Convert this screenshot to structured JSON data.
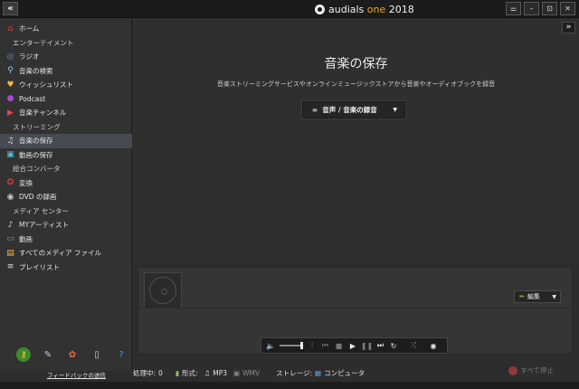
{
  "titlebar": {
    "collapse": "«",
    "brand_main": "audials ",
    "brand_accent": "one",
    "brand_year": " 2018",
    "controls": [
      "⚌",
      "–",
      "⊡",
      "✕"
    ]
  },
  "sidebar": {
    "items": [
      {
        "label": "ホーム",
        "icon": "home-icon",
        "glyph": "⌂",
        "color": "#e23b3b"
      },
      {
        "label": "エンターテイメント",
        "sub": true
      },
      {
        "label": "ラジオ",
        "icon": "radio-icon",
        "glyph": "◎",
        "color": "#3aa0e8"
      },
      {
        "label": "音楽の検索",
        "icon": "search-icon",
        "glyph": "⚲",
        "color": "#9fc8e8"
      },
      {
        "label": "ウィッシュリスト",
        "icon": "wishlist-icon",
        "glyph": "♥",
        "color": "#f0b83a"
      },
      {
        "label": "Podcast",
        "icon": "podcast-icon",
        "glyph": "●",
        "color": "#a74ad0"
      },
      {
        "label": "音楽チャンネル",
        "icon": "music-channel-icon",
        "glyph": "▶",
        "color": "#e04848"
      },
      {
        "label": "ストリーミング",
        "sub": true
      },
      {
        "label": "音楽の保存",
        "icon": "music-save-icon",
        "glyph": "♫",
        "color": "#dddddd",
        "selected": true
      },
      {
        "label": "動画の保存",
        "icon": "video-save-icon",
        "glyph": "▣",
        "color": "#48c0e0"
      },
      {
        "label": "総合コンバータ",
        "sub": true
      },
      {
        "label": "変換",
        "icon": "convert-icon",
        "glyph": "✪",
        "color": "#e03a3a"
      },
      {
        "label": "DVD の録画",
        "icon": "dvd-icon",
        "glyph": "◉",
        "color": "#cccccc"
      },
      {
        "label": "メディア センター",
        "sub": true
      },
      {
        "label": "MYアーティスト",
        "icon": "artist-icon",
        "glyph": "♪",
        "color": "#dddddd"
      },
      {
        "label": "動画",
        "icon": "video-icon",
        "glyph": "▭",
        "color": "#5aa0e8"
      },
      {
        "label": "すべてのメディア ファイル",
        "icon": "all-media-icon",
        "glyph": "▤",
        "color": "#f0b83a"
      },
      {
        "label": "プレイリスト",
        "icon": "playlist-icon",
        "glyph": "≡",
        "color": "#dddddd"
      }
    ],
    "tools": [
      {
        "name": "key-icon",
        "glyph": "⚷",
        "bg": "#3f8a2a",
        "color": "#f0d040"
      },
      {
        "name": "wrench-icon",
        "glyph": "✎",
        "bg": "transparent",
        "color": "#cfcfcf"
      },
      {
        "name": "color-wheel-icon",
        "glyph": "✿",
        "bg": "transparent",
        "color": "#f06a3a"
      },
      {
        "name": "phone-icon",
        "glyph": "▯",
        "bg": "transparent",
        "color": "#cfcfcf"
      },
      {
        "name": "help-icon",
        "glyph": "?",
        "bg": "transparent",
        "color": "#4a90e8"
      }
    ],
    "feedback": "フィードバックの送信"
  },
  "main": {
    "expand": "»",
    "title": "音楽の保存",
    "subtitle": "音楽ストリーミングサービスやオンラインミュージックストアから音楽やオーディオブックを録音",
    "record_label": "音声 / 音楽の録音",
    "record_glyph": "∞",
    "caret": "▼"
  },
  "lower": {
    "edit_label": "編集",
    "edit_glyph": "✏"
  },
  "player": {
    "buttons": [
      {
        "name": "volume-icon",
        "glyph": "🔈"
      },
      {
        "name": "equalizer-icon",
        "glyph": "⫶"
      },
      {
        "name": "previous-icon",
        "glyph": "⏮",
        "dim": true
      },
      {
        "name": "stop-icon",
        "glyph": "■",
        "dim": true
      },
      {
        "name": "play-icon",
        "glyph": "▶"
      },
      {
        "name": "pause-icon",
        "glyph": "❚❚",
        "dim": true
      },
      {
        "name": "next-icon",
        "glyph": "⏭"
      },
      {
        "name": "repeat-icon",
        "glyph": "↻"
      },
      {
        "name": "shuffle-icon",
        "glyph": "⤮",
        "dim": true
      },
      {
        "name": "visibility-icon",
        "glyph": "◉"
      }
    ]
  },
  "status": {
    "processing_label": "処理中:",
    "processing_count": "0",
    "format_label": "形式:",
    "format_mp3": "MP3",
    "format_wmv": "WMV",
    "storage_label": "ストレージ:",
    "storage_value": "コンピュータ",
    "stop_all": "すべて停止"
  }
}
